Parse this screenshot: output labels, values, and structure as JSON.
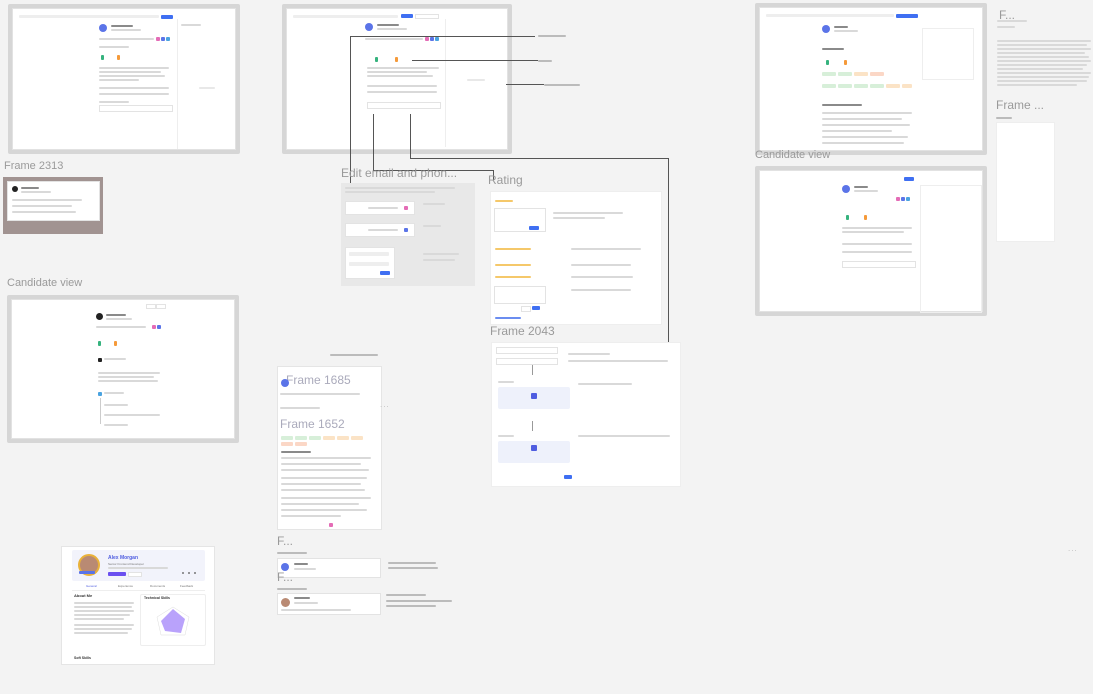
{
  "canvas": {
    "background": "#f3f3f3",
    "accent": "#3f6ff2",
    "overflow_menu": "..."
  },
  "frames": {
    "frame_2313": {
      "label": "Frame 2313"
    },
    "candidate_view_left": {
      "label": "Candidate view"
    },
    "edit_email": {
      "label": "Edit email and phon..."
    },
    "rating": {
      "label": "Rating"
    },
    "frame_2043": {
      "label": "Frame 2043"
    },
    "candidate_view_right": {
      "label": "Candidate view"
    },
    "frame_f_top": {
      "label": "F..."
    },
    "frame_dots": {
      "label": "Frame ..."
    },
    "frame_1685": {
      "label": "Frame 1685"
    },
    "frame_1652": {
      "label": "Frame 1652"
    },
    "frame_f_mid": {
      "label": "F..."
    },
    "frame_f_low": {
      "label": "F..."
    }
  },
  "profile_card": {
    "name": "Alex Morgan",
    "subtitle": "Senior Frontend Developer",
    "tabs": [
      "General",
      "Experience",
      "Documents",
      "Feedback"
    ],
    "about_heading": "About Me",
    "tech_heading": "Technical Skills",
    "soft_heading": "Soft Skills",
    "radar_color": "#a78bfa"
  }
}
